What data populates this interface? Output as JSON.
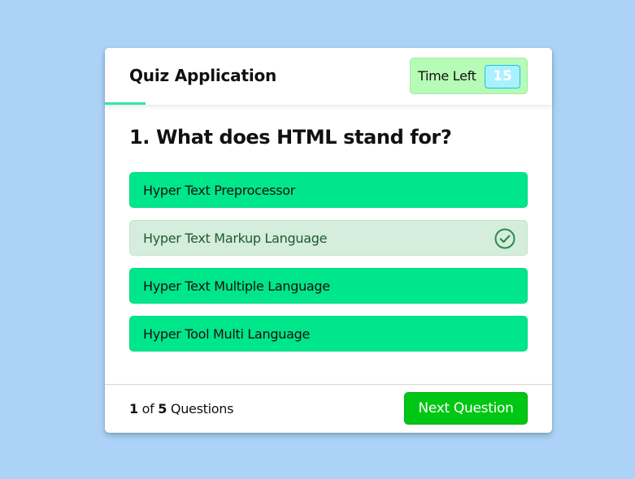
{
  "header": {
    "title": "Quiz Application",
    "timer_label": "Time Left",
    "timer_seconds": "15",
    "time_progress_fraction": 0.09
  },
  "question": {
    "text": "1. What does HTML stand for?"
  },
  "options": [
    {
      "label": "Hyper Text Preprocessor",
      "state": "default"
    },
    {
      "label": "Hyper Text Markup Language",
      "state": "correct",
      "icon": "check-circle-icon"
    },
    {
      "label": "Hyper Text Multiple Language",
      "state": "default"
    },
    {
      "label": "Hyper Tool Multi Language",
      "state": "default"
    }
  ],
  "footer": {
    "current": "1",
    "of_word": "of",
    "total": "5",
    "questions_word": "Questions",
    "next_label": "Next Question"
  },
  "colors": {
    "background": "#acd3f7",
    "option_default": "#00e68a",
    "option_correct": "#d4eddc",
    "correct_icon": "#2e8a47",
    "timer_bg": "#b6fcb6",
    "timer_seconds_bg": "#a9f1ff",
    "time_line": "#2ee8a6",
    "next_button": "#00c714"
  }
}
